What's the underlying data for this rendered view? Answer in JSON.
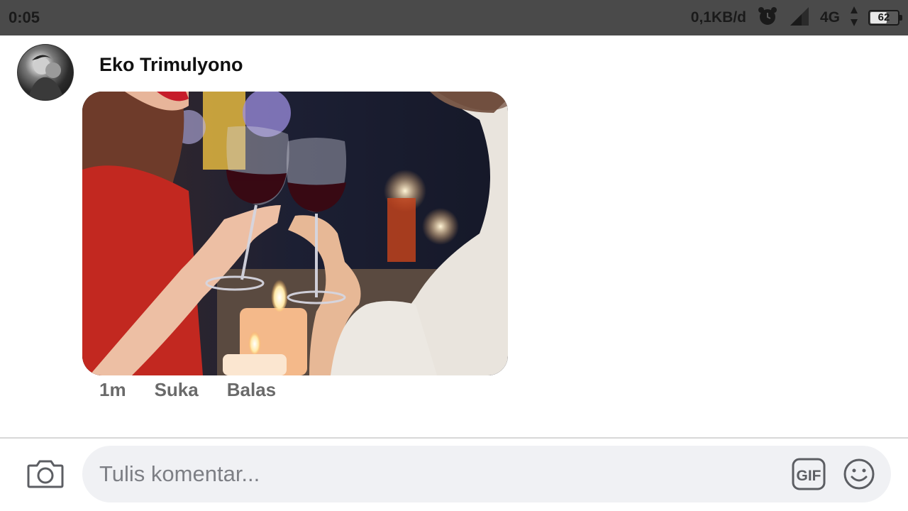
{
  "status_bar": {
    "time": "0:05",
    "network_speed": "0,1KB/d",
    "network_type": "4G",
    "battery_percent": "62",
    "battery_level": 0.62,
    "icons": [
      "alarm-clock-icon",
      "signal-icon",
      "data-arrows-icon",
      "battery-icon"
    ]
  },
  "comment": {
    "author": "Eko Trimulyono",
    "avatar_icon": "avatar",
    "image_icon": "photo-wine-toast",
    "time_ago": "1m",
    "like_label": "Suka",
    "reply_label": "Balas"
  },
  "composer": {
    "placeholder": "Tulis komentar...",
    "camera_icon": "camera-icon",
    "gif_label": "GIF",
    "emoji_icon": "emoji-icon"
  },
  "colors": {
    "status_bar_bg": "#4a4a4a",
    "meta_text": "#6a6a6a",
    "composer_bg": "#f0f1f4"
  }
}
